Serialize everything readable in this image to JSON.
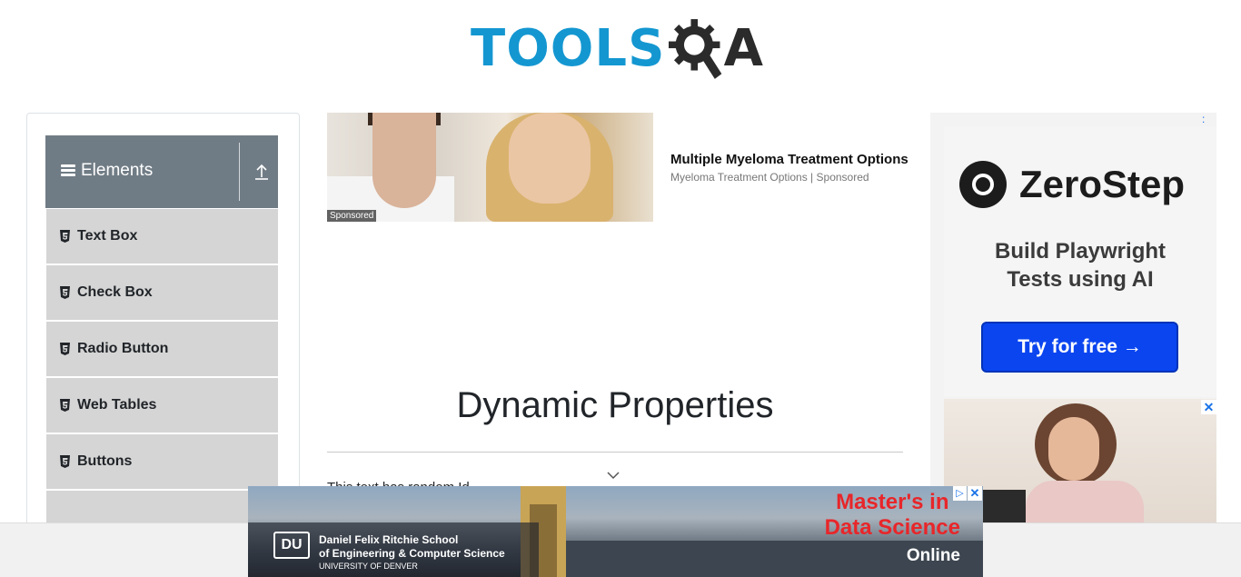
{
  "header": {
    "logo_text": "TOOLS",
    "logo_suffix": "A"
  },
  "sidebar": {
    "group_title": "Elements",
    "items": [
      {
        "label": "Text Box"
      },
      {
        "label": "Check Box"
      },
      {
        "label": "Radio Button"
      },
      {
        "label": "Web Tables"
      },
      {
        "label": "Buttons"
      }
    ]
  },
  "sponsored_ad": {
    "tag": "Sponsored",
    "title": "Multiple Myeloma Treatment Options",
    "source": "Myeloma Treatment Options | Sponsored"
  },
  "main": {
    "heading": "Dynamic Properties",
    "random_text": "This text has random Id"
  },
  "right_ad": {
    "brand": "ZeroStep",
    "tagline_line1": "Build Playwright",
    "tagline_line2": "Tests using AI",
    "cta": "Try for free →",
    "close": "✕",
    "choices": ":"
  },
  "bottom_ad": {
    "logo": "DU",
    "school_line1": "Daniel Felix Ritchie School",
    "school_line2": "of Engineering & Computer Science",
    "school_line3": "UNIVERSITY OF DENVER",
    "headline_line1": "Master's in",
    "headline_line2": "Data Science",
    "online": "Online",
    "info": "▷",
    "close": "✕"
  },
  "colors": {
    "brand_blue": "#1497d1",
    "sidebar_header": "#707c85",
    "menu_item_bg": "#d5d5d5",
    "cta_blue": "#0a45f0",
    "ad_red": "#e8262a"
  }
}
